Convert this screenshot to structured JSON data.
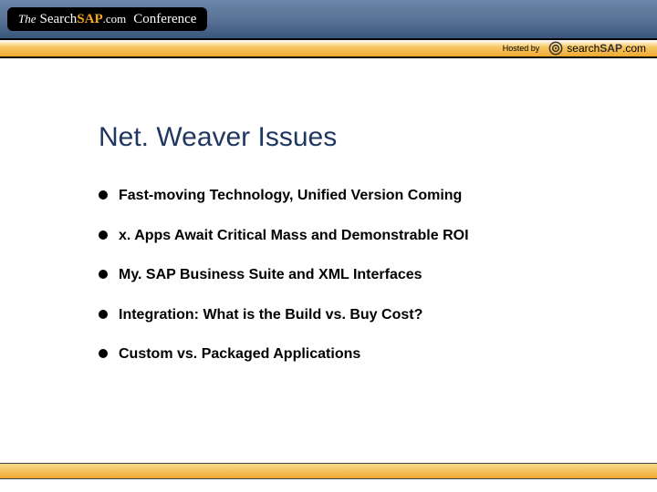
{
  "header": {
    "badge": {
      "the": "The",
      "search": "Search",
      "sap": "SAP",
      "dotcom": ".com",
      "conference": "Conference"
    }
  },
  "orange_band": {
    "hosted_by": "Hosted by",
    "logo_search": "search",
    "logo_sap": "SAP",
    "logo_dotcom": ".com"
  },
  "slide": {
    "title": "Net. Weaver Issues",
    "bullets": [
      "Fast-moving Technology, Unified Version Coming",
      "x. Apps Await Critical Mass and Demonstrable ROI",
      "My. SAP Business Suite and XML Interfaces",
      "Integration: What is the Build vs. Buy Cost?",
      "Custom vs. Packaged Applications"
    ]
  }
}
